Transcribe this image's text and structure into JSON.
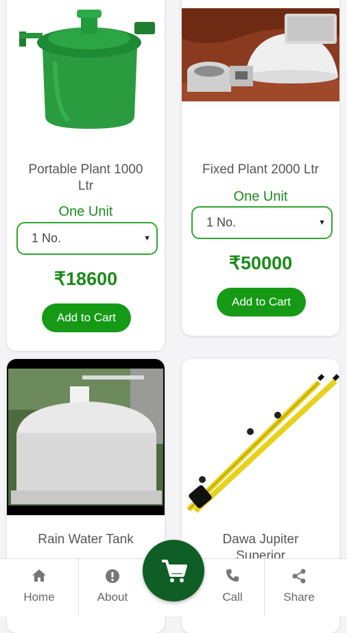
{
  "products": [
    {
      "title": "Portable Plant 1000 Ltr",
      "unit_label": "One Unit",
      "select_value": "1 No.",
      "price": "₹18600",
      "cart_label": "Add to Cart"
    },
    {
      "title": "Fixed Plant 2000 Ltr",
      "unit_label": "One Unit",
      "select_value": "1 No.",
      "price": "₹50000",
      "cart_label": "Add to Cart"
    },
    {
      "title": "Rain Water Tank"
    },
    {
      "title": "Dawa Jupiter Superior"
    }
  ],
  "nav": {
    "home": "Home",
    "about": "About",
    "call": "Call",
    "share": "Share"
  },
  "colors": {
    "accent": "#169a16",
    "fab": "#0e5e25",
    "price": "#1b8a1b"
  },
  "icons": {
    "home": "home-icon",
    "about": "info-icon",
    "cart": "cart-icon",
    "call": "phone-icon",
    "share": "share-icon"
  }
}
